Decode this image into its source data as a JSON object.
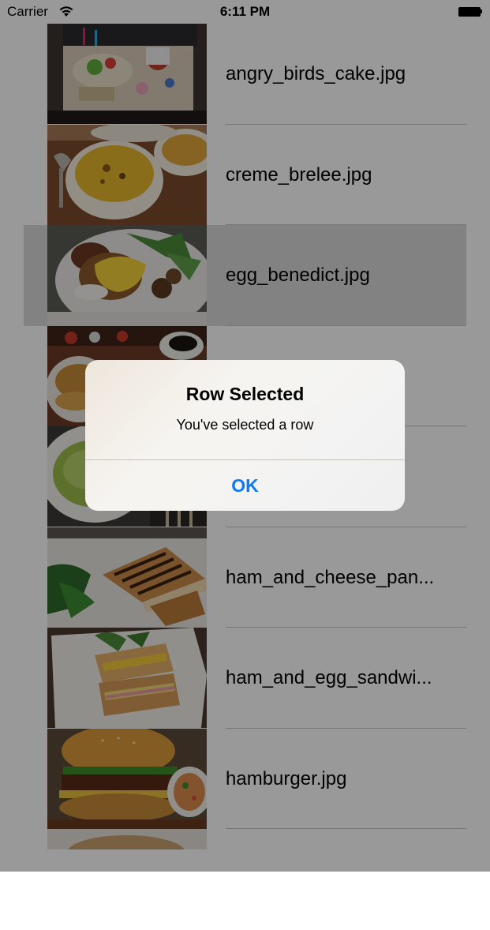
{
  "status_bar": {
    "carrier": "Carrier",
    "time": "6:11 PM",
    "wifi_icon": "wifi-icon",
    "battery_icon": "battery-icon"
  },
  "rows": [
    {
      "label": "angry_birds_cake.jpg",
      "selected": false
    },
    {
      "label": "creme_brelee.jpg",
      "selected": false
    },
    {
      "label": "egg_benedict.jpg",
      "selected": true
    },
    {
      "label": "",
      "selected": false
    },
    {
      "label": "",
      "selected": false
    },
    {
      "label": "ham_and_cheese_pan...",
      "selected": false
    },
    {
      "label": "ham_and_egg_sandwi...",
      "selected": false
    },
    {
      "label": "hamburger.jpg",
      "selected": false
    }
  ],
  "alert": {
    "title": "Row Selected",
    "message": "You've selected a row",
    "ok_label": "OK",
    "ok_color": "#0a7af5"
  }
}
